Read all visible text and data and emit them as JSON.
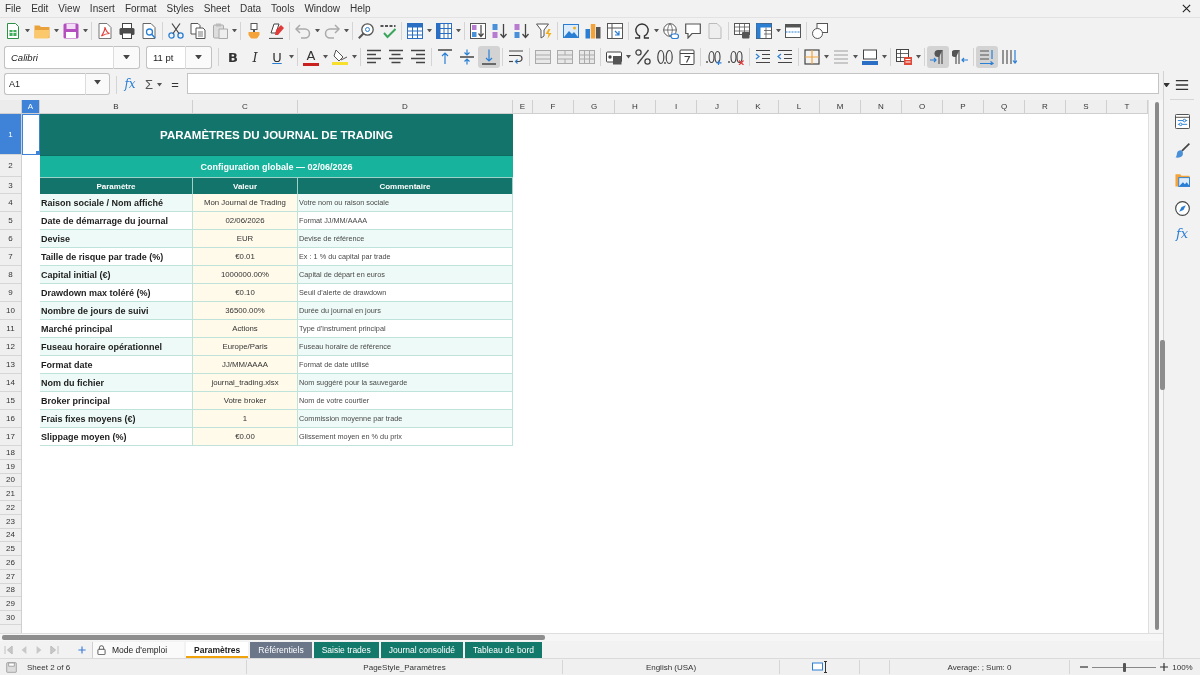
{
  "menu_bar": {
    "items": [
      "File",
      "Edit",
      "View",
      "Insert",
      "Format",
      "Styles",
      "Sheet",
      "Data",
      "Tools",
      "Window",
      "Help"
    ]
  },
  "format_toolbar": {
    "font_name": "Calibri",
    "font_size": "11 pt",
    "bold": {
      "label": "B",
      "on": false
    },
    "italic": {
      "label": "I",
      "on": false
    },
    "underline": {
      "label": "U",
      "on": false
    },
    "font_color_label": "A",
    "align_left": false,
    "align_center": false,
    "align_right": false,
    "align_top": false,
    "align_middle": false,
    "align_bottom": true,
    "paragraph_ltr": true,
    "paragraph_rtl": false,
    "text_horizontal": true,
    "text_vertical": false
  },
  "formula_bar": {
    "name_box": "A1",
    "function_wizard": "fx",
    "sum": "Σ",
    "equals": "="
  },
  "sidebar": {
    "functions": "fx"
  },
  "column_headers": [
    {
      "label": "A",
      "selected": true
    },
    {
      "label": "B",
      "selected": false
    },
    {
      "label": "C",
      "selected": false
    },
    {
      "label": "D",
      "selected": false
    },
    {
      "label": "E",
      "selected": false
    },
    {
      "label": "F",
      "selected": false
    },
    {
      "label": "G",
      "selected": false
    },
    {
      "label": "H",
      "selected": false
    },
    {
      "label": "I",
      "selected": false
    },
    {
      "label": "J",
      "selected": false
    },
    {
      "label": "K",
      "selected": false
    },
    {
      "label": "L",
      "selected": false
    },
    {
      "label": "M",
      "selected": false
    },
    {
      "label": "N",
      "selected": false
    },
    {
      "label": "O",
      "selected": false
    },
    {
      "label": "P",
      "selected": false
    },
    {
      "label": "Q",
      "selected": false
    },
    {
      "label": "R",
      "selected": false
    },
    {
      "label": "S",
      "selected": false
    },
    {
      "label": "T",
      "selected": false
    }
  ],
  "row_headers": [
    {
      "label": "1",
      "selected": true
    },
    {
      "label": "2",
      "selected": false
    },
    {
      "label": "3",
      "selected": false
    },
    {
      "label": "4",
      "selected": false
    },
    {
      "label": "5",
      "selected": false
    },
    {
      "label": "6",
      "selected": false
    },
    {
      "label": "7",
      "selected": false
    },
    {
      "label": "8",
      "selected": false
    },
    {
      "label": "9",
      "selected": false
    },
    {
      "label": "10",
      "selected": false
    },
    {
      "label": "11",
      "selected": false
    },
    {
      "label": "12",
      "selected": false
    },
    {
      "label": "13",
      "selected": false
    },
    {
      "label": "14",
      "selected": false
    },
    {
      "label": "15",
      "selected": false
    },
    {
      "label": "16",
      "selected": false
    },
    {
      "label": "17",
      "selected": false
    },
    {
      "label": "18",
      "selected": false
    },
    {
      "label": "19",
      "selected": false
    },
    {
      "label": "20",
      "selected": false
    },
    {
      "label": "21",
      "selected": false
    },
    {
      "label": "22",
      "selected": false
    },
    {
      "label": "23",
      "selected": false
    },
    {
      "label": "24",
      "selected": false
    },
    {
      "label": "25",
      "selected": false
    },
    {
      "label": "26",
      "selected": false
    },
    {
      "label": "27",
      "selected": false
    },
    {
      "label": "28",
      "selected": false
    },
    {
      "label": "29",
      "selected": false
    },
    {
      "label": "30",
      "selected": false
    }
  ],
  "sheet": {
    "title": "PARAMÈTRES DU JOURNAL DE TRADING",
    "subtitle": "Configuration globale — 02/06/2026",
    "columns": [
      "Paramètre",
      "Valeur",
      "Commentaire"
    ],
    "rows": [
      {
        "parameter": "Raison sociale / Nom affiché",
        "value": "Mon Journal de Trading",
        "comment": "Votre nom ou raison sociale"
      },
      {
        "parameter": "Date de démarrage du journal",
        "value": "02/06/2026",
        "comment": "Format JJ/MM/AAAA"
      },
      {
        "parameter": "Devise",
        "value": "EUR",
        "comment": "Devise de référence"
      },
      {
        "parameter": "Taille de risque par trade (%)",
        "value": "€0.01",
        "comment": "Ex : 1 % du capital par trade"
      },
      {
        "parameter": "Capital initial (€)",
        "value": "1000000.00%",
        "comment": "Capital de départ en euros"
      },
      {
        "parameter": "Drawdown max toléré (%)",
        "value": "€0.10",
        "comment": "Seuil d'alerte de drawdown"
      },
      {
        "parameter": "Nombre de jours de suivi",
        "value": "36500.00%",
        "comment": "Durée du journal en jours"
      },
      {
        "parameter": "Marché principal",
        "value": "Actions",
        "comment": "Type d'instrument principal"
      },
      {
        "parameter": "Fuseau horaire opérationnel",
        "value": "Europe/Paris",
        "comment": "Fuseau horaire de référence"
      },
      {
        "parameter": "Format date",
        "value": "JJ/MM/AAAA",
        "comment": "Format de date utilisé"
      },
      {
        "parameter": "Nom du fichier",
        "value": "journal_trading.xlsx",
        "comment": "Nom suggéré pour la sauvegarde"
      },
      {
        "parameter": "Broker principal",
        "value": "Votre broker",
        "comment": "Nom de votre courtier"
      },
      {
        "parameter": "Frais fixes moyens (€)",
        "value": "1",
        "comment": "Commission moyenne par trade"
      },
      {
        "parameter": "Slippage moyen (%)",
        "value": "€0.00",
        "comment": "Glissement moyen en % du prix"
      }
    ]
  },
  "sheet_tabs": [
    {
      "label": "Mode d'emploi",
      "selected": false,
      "protected": true
    },
    {
      "label": "Paramètres",
      "selected": true,
      "protected": false,
      "color": "#f0a30a"
    },
    {
      "label": "Référentiels",
      "selected": false,
      "protected": false,
      "color": "#6b7789"
    },
    {
      "label": "Saisie trades",
      "selected": false,
      "protected": false,
      "color": "#137a6b"
    },
    {
      "label": "Journal consolidé",
      "selected": false,
      "protected": false,
      "color": "#137a6b"
    },
    {
      "label": "Tableau de bord",
      "selected": false,
      "protected": false,
      "color": "#137a6b"
    }
  ],
  "status_bar": {
    "sheet_position": "Sheet 2 of 6",
    "page_style": "PageStyle_Paramètres",
    "language": "English (USA)",
    "selection_summary": "Average: ; Sum: 0",
    "zoom": "100%"
  },
  "zoom_slider": {
    "level": 0.5
  }
}
